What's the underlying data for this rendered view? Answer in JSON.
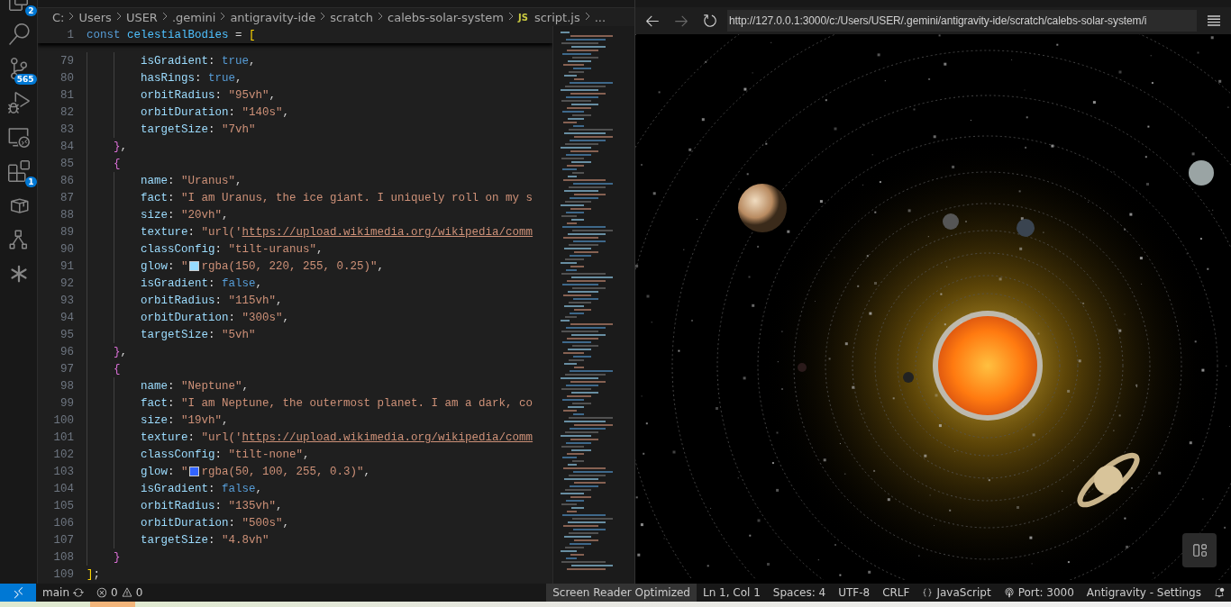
{
  "activity_bar": {
    "items": [
      {
        "kind": "files",
        "badge": "2"
      },
      {
        "kind": "search"
      },
      {
        "kind": "scm",
        "badge": "565"
      },
      {
        "kind": "debug"
      },
      {
        "kind": "remote"
      },
      {
        "kind": "extensions",
        "badge": "1"
      },
      {
        "kind": "box"
      },
      {
        "kind": "diagram"
      },
      {
        "kind": "spark"
      }
    ]
  },
  "editor": {
    "breadcrumbs": [
      {
        "label": "C:"
      },
      {
        "label": "Users"
      },
      {
        "label": "USER"
      },
      {
        "label": ".gemini"
      },
      {
        "label": "antigravity-ide"
      },
      {
        "label": "scratch"
      },
      {
        "label": "calebs-solar-system"
      },
      {
        "label": "script.js",
        "file_badge": "JS"
      },
      {
        "label": "..."
      }
    ],
    "sticky_line": {
      "number": "1",
      "tokens": [
        {
          "kind": "kw",
          "text": "const "
        },
        {
          "kind": "var",
          "text": "celestialBodies"
        },
        {
          "kind": "punct",
          "text": " = "
        },
        {
          "kind": "bracket",
          "text": "["
        }
      ]
    },
    "lines": [
      {
        "number": "79",
        "tokens": [
          {
            "kind": "key",
            "text": "        isGradient"
          },
          {
            "kind": "punct",
            "text": ": "
          },
          {
            "kind": "kw",
            "text": "true"
          },
          {
            "kind": "punct",
            "text": ","
          }
        ]
      },
      {
        "number": "80",
        "tokens": [
          {
            "kind": "key",
            "text": "        hasRings"
          },
          {
            "kind": "punct",
            "text": ": "
          },
          {
            "kind": "kw",
            "text": "true"
          },
          {
            "kind": "punct",
            "text": ","
          }
        ]
      },
      {
        "number": "81",
        "tokens": [
          {
            "kind": "key",
            "text": "        orbitRadius"
          },
          {
            "kind": "punct",
            "text": ": "
          },
          {
            "kind": "str",
            "text": "\"95vh\""
          },
          {
            "kind": "punct",
            "text": ","
          }
        ]
      },
      {
        "number": "82",
        "tokens": [
          {
            "kind": "key",
            "text": "        orbitDuration"
          },
          {
            "kind": "punct",
            "text": ": "
          },
          {
            "kind": "str",
            "text": "\"140s\""
          },
          {
            "kind": "punct",
            "text": ","
          }
        ]
      },
      {
        "number": "83",
        "tokens": [
          {
            "kind": "key",
            "text": "        targetSize"
          },
          {
            "kind": "punct",
            "text": ": "
          },
          {
            "kind": "str",
            "text": "\"7vh\""
          }
        ]
      },
      {
        "number": "84",
        "tokens": [
          {
            "kind": "brace",
            "text": "    }"
          },
          {
            "kind": "punct",
            "text": ","
          }
        ]
      },
      {
        "number": "85",
        "tokens": [
          {
            "kind": "brace",
            "text": "    {"
          }
        ]
      },
      {
        "number": "86",
        "tokens": [
          {
            "kind": "key",
            "text": "        name"
          },
          {
            "kind": "punct",
            "text": ": "
          },
          {
            "kind": "str",
            "text": "\"Uranus\""
          },
          {
            "kind": "punct",
            "text": ","
          }
        ]
      },
      {
        "number": "87",
        "tokens": [
          {
            "kind": "key",
            "text": "        fact"
          },
          {
            "kind": "punct",
            "text": ": "
          },
          {
            "kind": "str",
            "text": "\"I am Uranus, the ice giant. I uniquely roll on my s"
          }
        ]
      },
      {
        "number": "88",
        "tokens": [
          {
            "kind": "key",
            "text": "        size"
          },
          {
            "kind": "punct",
            "text": ": "
          },
          {
            "kind": "str",
            "text": "\"20vh\""
          },
          {
            "kind": "punct",
            "text": ","
          }
        ]
      },
      {
        "number": "89",
        "tokens": [
          {
            "kind": "key",
            "text": "        texture"
          },
          {
            "kind": "punct",
            "text": ": "
          },
          {
            "kind": "str",
            "text": "\"url('"
          },
          {
            "kind": "link",
            "text": "https://upload.wikimedia.org/wikipedia/comm"
          }
        ]
      },
      {
        "number": "90",
        "tokens": [
          {
            "kind": "key",
            "text": "        classConfig"
          },
          {
            "kind": "punct",
            "text": ": "
          },
          {
            "kind": "str",
            "text": "\"tilt-uranus\""
          },
          {
            "kind": "punct",
            "text": ","
          }
        ]
      },
      {
        "number": "91",
        "tokens": [
          {
            "kind": "key",
            "text": "        glow"
          },
          {
            "kind": "punct",
            "text": ": "
          },
          {
            "kind": "str",
            "text": "\""
          },
          {
            "kind": "swatch",
            "color": "#96dcff"
          },
          {
            "kind": "str",
            "text": "rgba(150, 220, 255, 0.25)\""
          },
          {
            "kind": "punct",
            "text": ","
          }
        ]
      },
      {
        "number": "92",
        "tokens": [
          {
            "kind": "key",
            "text": "        isGradient"
          },
          {
            "kind": "punct",
            "text": ": "
          },
          {
            "kind": "kw",
            "text": "false"
          },
          {
            "kind": "punct",
            "text": ","
          }
        ]
      },
      {
        "number": "93",
        "tokens": [
          {
            "kind": "key",
            "text": "        orbitRadius"
          },
          {
            "kind": "punct",
            "text": ": "
          },
          {
            "kind": "str",
            "text": "\"115vh\""
          },
          {
            "kind": "punct",
            "text": ","
          }
        ]
      },
      {
        "number": "94",
        "tokens": [
          {
            "kind": "key",
            "text": "        orbitDuration"
          },
          {
            "kind": "punct",
            "text": ": "
          },
          {
            "kind": "str",
            "text": "\"300s\""
          },
          {
            "kind": "punct",
            "text": ","
          }
        ]
      },
      {
        "number": "95",
        "tokens": [
          {
            "kind": "key",
            "text": "        targetSize"
          },
          {
            "kind": "punct",
            "text": ": "
          },
          {
            "kind": "str",
            "text": "\"5vh\""
          }
        ]
      },
      {
        "number": "96",
        "tokens": [
          {
            "kind": "brace",
            "text": "    }"
          },
          {
            "kind": "punct",
            "text": ","
          }
        ]
      },
      {
        "number": "97",
        "tokens": [
          {
            "kind": "brace",
            "text": "    {"
          }
        ]
      },
      {
        "number": "98",
        "tokens": [
          {
            "kind": "key",
            "text": "        name"
          },
          {
            "kind": "punct",
            "text": ": "
          },
          {
            "kind": "str",
            "text": "\"Neptune\""
          },
          {
            "kind": "punct",
            "text": ","
          }
        ]
      },
      {
        "number": "99",
        "tokens": [
          {
            "kind": "key",
            "text": "        fact"
          },
          {
            "kind": "punct",
            "text": ": "
          },
          {
            "kind": "str",
            "text": "\"I am Neptune, the outermost planet. I am a dark, co"
          }
        ]
      },
      {
        "number": "100",
        "tokens": [
          {
            "kind": "key",
            "text": "        size"
          },
          {
            "kind": "punct",
            "text": ": "
          },
          {
            "kind": "str",
            "text": "\"19vh\""
          },
          {
            "kind": "punct",
            "text": ","
          }
        ]
      },
      {
        "number": "101",
        "tokens": [
          {
            "kind": "key",
            "text": "        texture"
          },
          {
            "kind": "punct",
            "text": ": "
          },
          {
            "kind": "str",
            "text": "\"url('"
          },
          {
            "kind": "link",
            "text": "https://upload.wikimedia.org/wikipedia/comm"
          }
        ]
      },
      {
        "number": "102",
        "tokens": [
          {
            "kind": "key",
            "text": "        classConfig"
          },
          {
            "kind": "punct",
            "text": ": "
          },
          {
            "kind": "str",
            "text": "\"tilt-none\""
          },
          {
            "kind": "punct",
            "text": ","
          }
        ]
      },
      {
        "number": "103",
        "tokens": [
          {
            "kind": "key",
            "text": "        glow"
          },
          {
            "kind": "punct",
            "text": ": "
          },
          {
            "kind": "str",
            "text": "\""
          },
          {
            "kind": "swatch",
            "color": "#3264ff"
          },
          {
            "kind": "str",
            "text": "rgba(50, 100, 255, 0.3)\""
          },
          {
            "kind": "punct",
            "text": ","
          }
        ]
      },
      {
        "number": "104",
        "tokens": [
          {
            "kind": "key",
            "text": "        isGradient"
          },
          {
            "kind": "punct",
            "text": ": "
          },
          {
            "kind": "kw",
            "text": "false"
          },
          {
            "kind": "punct",
            "text": ","
          }
        ]
      },
      {
        "number": "105",
        "tokens": [
          {
            "kind": "key",
            "text": "        orbitRadius"
          },
          {
            "kind": "punct",
            "text": ": "
          },
          {
            "kind": "str",
            "text": "\"135vh\""
          },
          {
            "kind": "punct",
            "text": ","
          }
        ]
      },
      {
        "number": "106",
        "tokens": [
          {
            "kind": "key",
            "text": "        orbitDuration"
          },
          {
            "kind": "punct",
            "text": ": "
          },
          {
            "kind": "str",
            "text": "\"500s\""
          },
          {
            "kind": "punct",
            "text": ","
          }
        ]
      },
      {
        "number": "107",
        "tokens": [
          {
            "kind": "key",
            "text": "        targetSize"
          },
          {
            "kind": "punct",
            "text": ": "
          },
          {
            "kind": "str",
            "text": "\"4.8vh\""
          }
        ]
      },
      {
        "number": "108",
        "tokens": [
          {
            "kind": "brace",
            "text": "    }"
          }
        ]
      },
      {
        "number": "109",
        "tokens": [
          {
            "kind": "bracket",
            "text": "]"
          },
          {
            "kind": "punct",
            "text": ";"
          }
        ]
      }
    ]
  },
  "browser": {
    "back": {
      "disabled": false
    },
    "forward": {
      "disabled": true
    },
    "url": "http://127.0.0.1:3000/c:/Users/USER/.gemini/antigravity-ide/scratch/calebs-solar-system/i"
  },
  "status_bar": {
    "branch": "main",
    "errors": "0",
    "warnings": "0",
    "right_items": [
      {
        "kind": "text",
        "label": "Screen Reader Optimized",
        "selected": true
      },
      {
        "kind": "text",
        "label": "Ln 1, Col 1",
        "selected": false
      },
      {
        "kind": "text",
        "label": "Spaces: 4",
        "selected": false
      },
      {
        "kind": "text",
        "label": "UTF-8",
        "selected": false
      },
      {
        "kind": "text",
        "label": "CRLF",
        "selected": false
      },
      {
        "kind": "language",
        "label": "JavaScript",
        "selected": false
      },
      {
        "kind": "port",
        "label": "Port: 3000",
        "selected": false
      },
      {
        "kind": "text",
        "label": "Antigravity - Settings",
        "selected": false
      },
      {
        "kind": "bell",
        "selected": false
      }
    ]
  }
}
